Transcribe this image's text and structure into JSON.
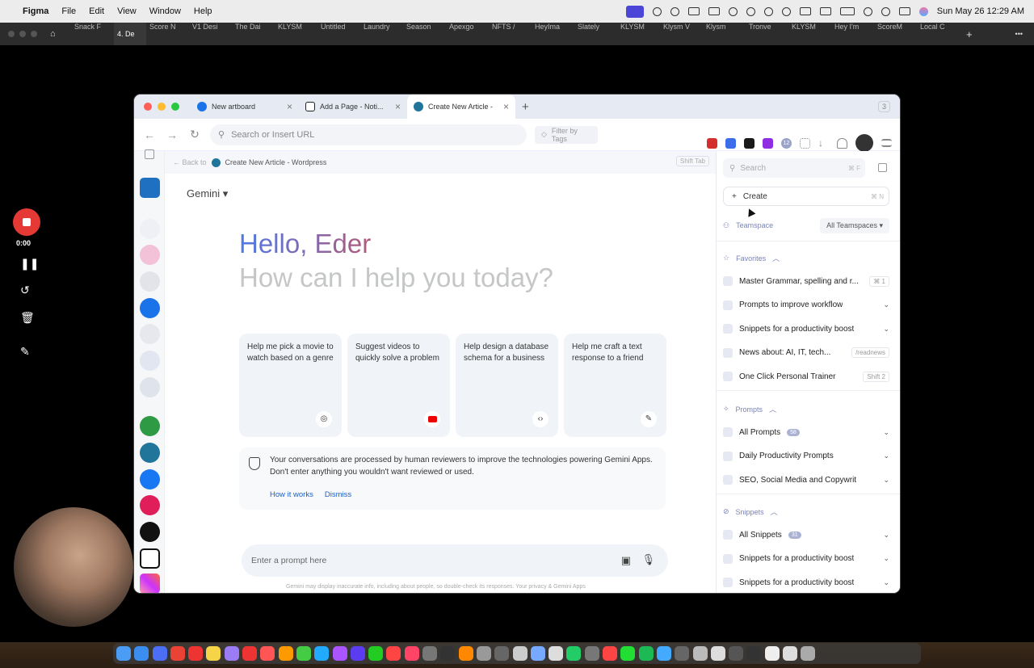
{
  "menubar": {
    "app": "Figma",
    "items": [
      "File",
      "Edit",
      "View",
      "Window",
      "Help"
    ],
    "datetime": "Sun May 26  12:29 AM"
  },
  "figma_tabs": [
    "Snack F",
    "4. De",
    "Score N",
    "V1 Desi",
    "The Dai",
    "KLYSM",
    "Untitled",
    "Laundry",
    "Season",
    "Apexgo",
    "NFTS /",
    "HeyIma",
    "Slately",
    "KLYSM",
    "Klysm V",
    "Klysm",
    "Tronve",
    "KLYSM",
    "Hey I'm",
    "ScoreM",
    "Local C"
  ],
  "figma_active_tab": 1,
  "browser": {
    "tabs": [
      {
        "label": "New artboard",
        "color": "#1a73e8"
      },
      {
        "label": "Add a Page - Noti...",
        "color": "#222"
      },
      {
        "label": "Create New Article -",
        "color": "#21759b"
      }
    ],
    "tab_count": "3",
    "url_placeholder": "Search or Insert URL",
    "filter_placeholder": "Filter by Tags",
    "extension_badge": "12"
  },
  "breadcrumb": {
    "back": "Back to",
    "page": "Create New Article - Wordpress",
    "shortcut": "Shift Tab"
  },
  "gemini": {
    "model": "Gemini",
    "hello": "Hello, Eder",
    "question": "How can I help you today?",
    "cards": [
      {
        "text": "Help me pick a movie to watch based on a genre",
        "icon": "compass-icon"
      },
      {
        "text": "Suggest videos to quickly solve a problem",
        "icon": "youtube-icon"
      },
      {
        "text": "Help design a database schema for a business",
        "icon": "code-icon"
      },
      {
        "text": "Help me craft a text response to a friend",
        "icon": "pen-icon"
      }
    ],
    "notice": "Your conversations are processed by human reviewers to improve the technologies powering Gemini Apps. Don't enter anything you wouldn't want reviewed or used.",
    "how_it_works": "How it works",
    "dismiss": "Dismiss",
    "prompt_placeholder": "Enter a prompt here",
    "disclaimer": "Gemini may display inaccurate info, including about people, so double-check its responses. Your privacy & Gemini Apps"
  },
  "sidebar": {
    "search": "Search",
    "search_key": "⌘ F",
    "create": "Create",
    "create_key": "⌘ N",
    "teamspace": "Teamspace",
    "teamspace_select": "All Teamspaces",
    "favorites_title": "Favorites",
    "favorites": [
      {
        "label": "Master Grammar, spelling and r...",
        "key": "⌘ 1"
      },
      {
        "label": "Prompts to improve workflow",
        "key": ""
      },
      {
        "label": "Snippets for a productivity boost",
        "key": ""
      },
      {
        "label": "News about: AI, IT, tech...",
        "key": "/readnews"
      },
      {
        "label": "One Click Personal Trainer",
        "key": "Shift 2"
      }
    ],
    "prompts_title": "Prompts",
    "prompts": [
      {
        "label": "All Prompts",
        "badge": "58"
      },
      {
        "label": "Daily Productivity Prompts",
        "badge": ""
      },
      {
        "label": "SEO, Social Media and Copywrit",
        "badge": ""
      }
    ],
    "snippets_title": "Snippets",
    "snippets": [
      {
        "label": "All Snippets",
        "badge": "31"
      },
      {
        "label": "Snippets for a productivity boost",
        "badge": ""
      },
      {
        "label": "Snippets for a productivity boost",
        "badge": ""
      }
    ]
  },
  "recorder": {
    "time": "0:00"
  }
}
